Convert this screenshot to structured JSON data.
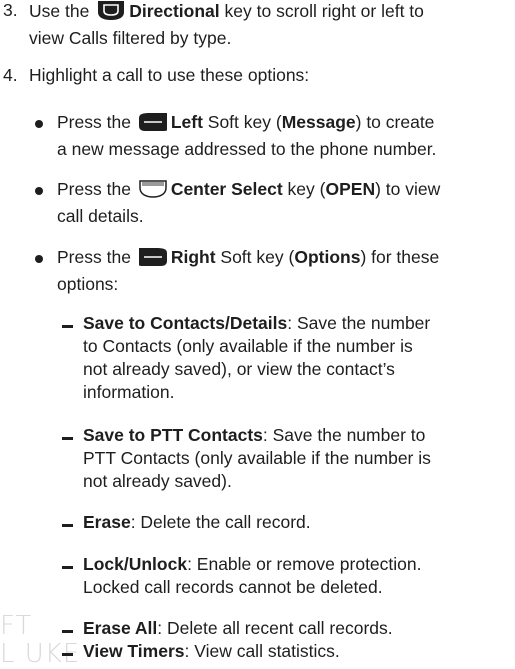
{
  "step3": {
    "num": "3.",
    "pre": "Use the",
    "key": "Directional",
    "post1": "key to scroll right or left to",
    "line2": "view Calls filtered by type."
  },
  "step4": {
    "num": "4.",
    "line1": "Highlight a call to use these options:"
  },
  "bullet_left": {
    "pre": "Press the",
    "key": "Left",
    "mid": "Soft key (",
    "action": "Message",
    "post": ") to create",
    "line2": "a new message addressed to the phone number."
  },
  "bullet_center": {
    "pre": "Press the",
    "key": "Center Select",
    "mid": "key (",
    "action": "OPEN",
    "post": ") to view",
    "line2": "call details."
  },
  "bullet_right": {
    "pre": "Press the",
    "key": "Right",
    "mid": "Soft key (",
    "action": "Options",
    "post": ") for these",
    "line2": "options:"
  },
  "options": [
    {
      "name": "Save to Contacts/Details",
      "lines": [
        ": Save the number",
        "to Contacts (only available if the number is",
        "not already saved), or view the contact’s",
        "information."
      ]
    },
    {
      "name": "Save to PTT Contacts",
      "lines": [
        ": Save the number to",
        "PTT Contacts (only available if the number is",
        "not already saved)."
      ]
    },
    {
      "name": "Erase",
      "lines": [
        ": Delete the call record."
      ]
    },
    {
      "name": "Lock/Unlock",
      "lines": [
        ": Enable or remove protection.",
        "Locked call records cannot be deleted."
      ]
    },
    {
      "name": "Erase All",
      "lines": [
        ": Delete all recent call records."
      ]
    },
    {
      "name": "View Timers",
      "lines": [
        ": View call statistics."
      ]
    }
  ],
  "watermark": {
    "line1": "FT",
    "line2": "L UKE"
  },
  "colors": {
    "text": "#1e1e1e",
    "icon_fill": "#1e1e1e",
    "watermark": "#d9d9d9"
  },
  "icons": [
    "directional-key-icon",
    "left-soft-key-icon",
    "center-select-key-icon",
    "right-soft-key-icon"
  ]
}
